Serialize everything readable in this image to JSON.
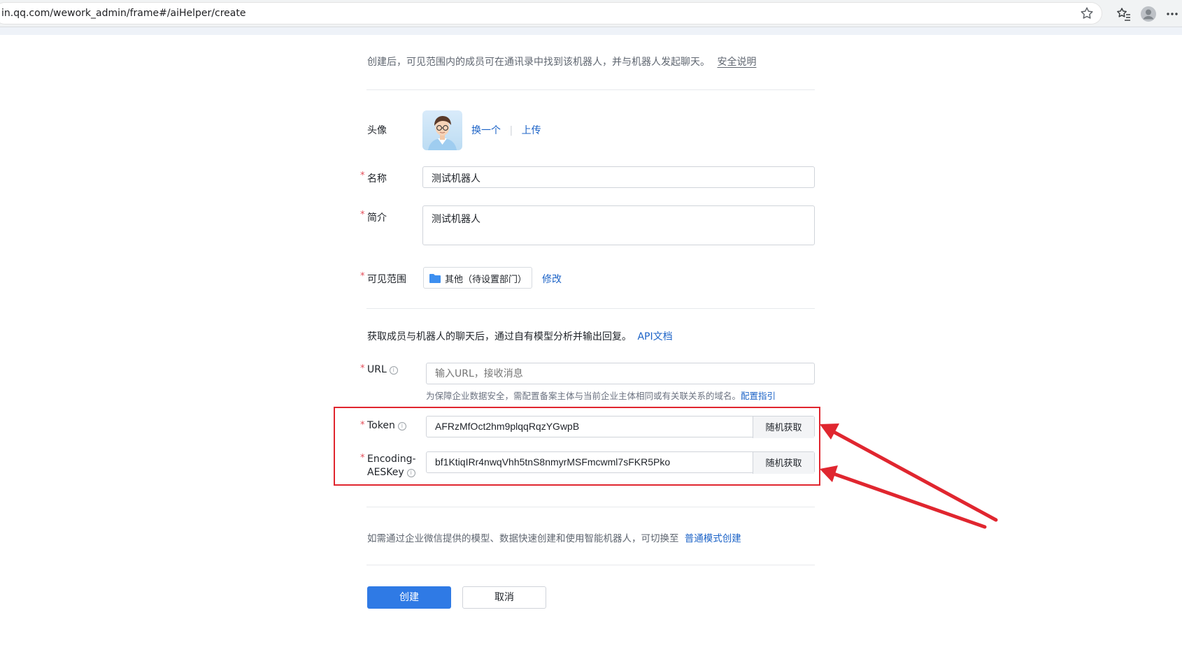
{
  "browser": {
    "url": "in.qq.com/wework_admin/frame#/aiHelper/create"
  },
  "intro": {
    "text": "创建后，可见范围内的成员可在通讯录中找到该机器人，并与机器人发起聊天。",
    "security_link": "安全说明"
  },
  "avatar": {
    "label": "头像",
    "change_link": "换一个",
    "upload_link": "上传"
  },
  "name": {
    "required_mark": "*",
    "label": "名称",
    "value": "测试机器人"
  },
  "description": {
    "required_mark": "*",
    "label": "简介",
    "value": "测试机器人"
  },
  "scope": {
    "required_mark": "*",
    "label": "可见范围",
    "value": "其他（待设置部门）",
    "edit_link": "修改"
  },
  "api_section": {
    "text": "获取成员与机器人的聊天后，通过自有模型分析并输出回复。",
    "doc_link": "API文档"
  },
  "url_field": {
    "required_mark": "*",
    "label": "URL",
    "info": "i",
    "placeholder": "输入URL，接收消息",
    "hint": "为保障企业数据安全，需配置备案主体与当前企业主体相同或有关联关系的域名。",
    "hint_link": "配置指引"
  },
  "token_field": {
    "required_mark": "*",
    "label": "Token",
    "info": "i",
    "value": "AFRzMfOct2hm9plqqRqzYGwpB",
    "random_button": "随机获取"
  },
  "aes_field": {
    "required_mark": "*",
    "label_line1": "Encoding-",
    "label_line2": "AESKey",
    "info": "i",
    "value": "bf1KtiqIRr4nwqVhh5tnS8nmyrMSFmcwml7sFKR5Pko",
    "random_button": "随机获取"
  },
  "switch_mode": {
    "text": "如需通过企业微信提供的模型、数据快速创建和使用智能机器人，可切换至",
    "link": "普通模式创建"
  },
  "actions": {
    "create": "创建",
    "cancel": "取消"
  },
  "colors": {
    "primary": "#2f7ae5",
    "link": "#1c63c7",
    "annotation_red": "#e0262f",
    "required": "#e34d59"
  }
}
